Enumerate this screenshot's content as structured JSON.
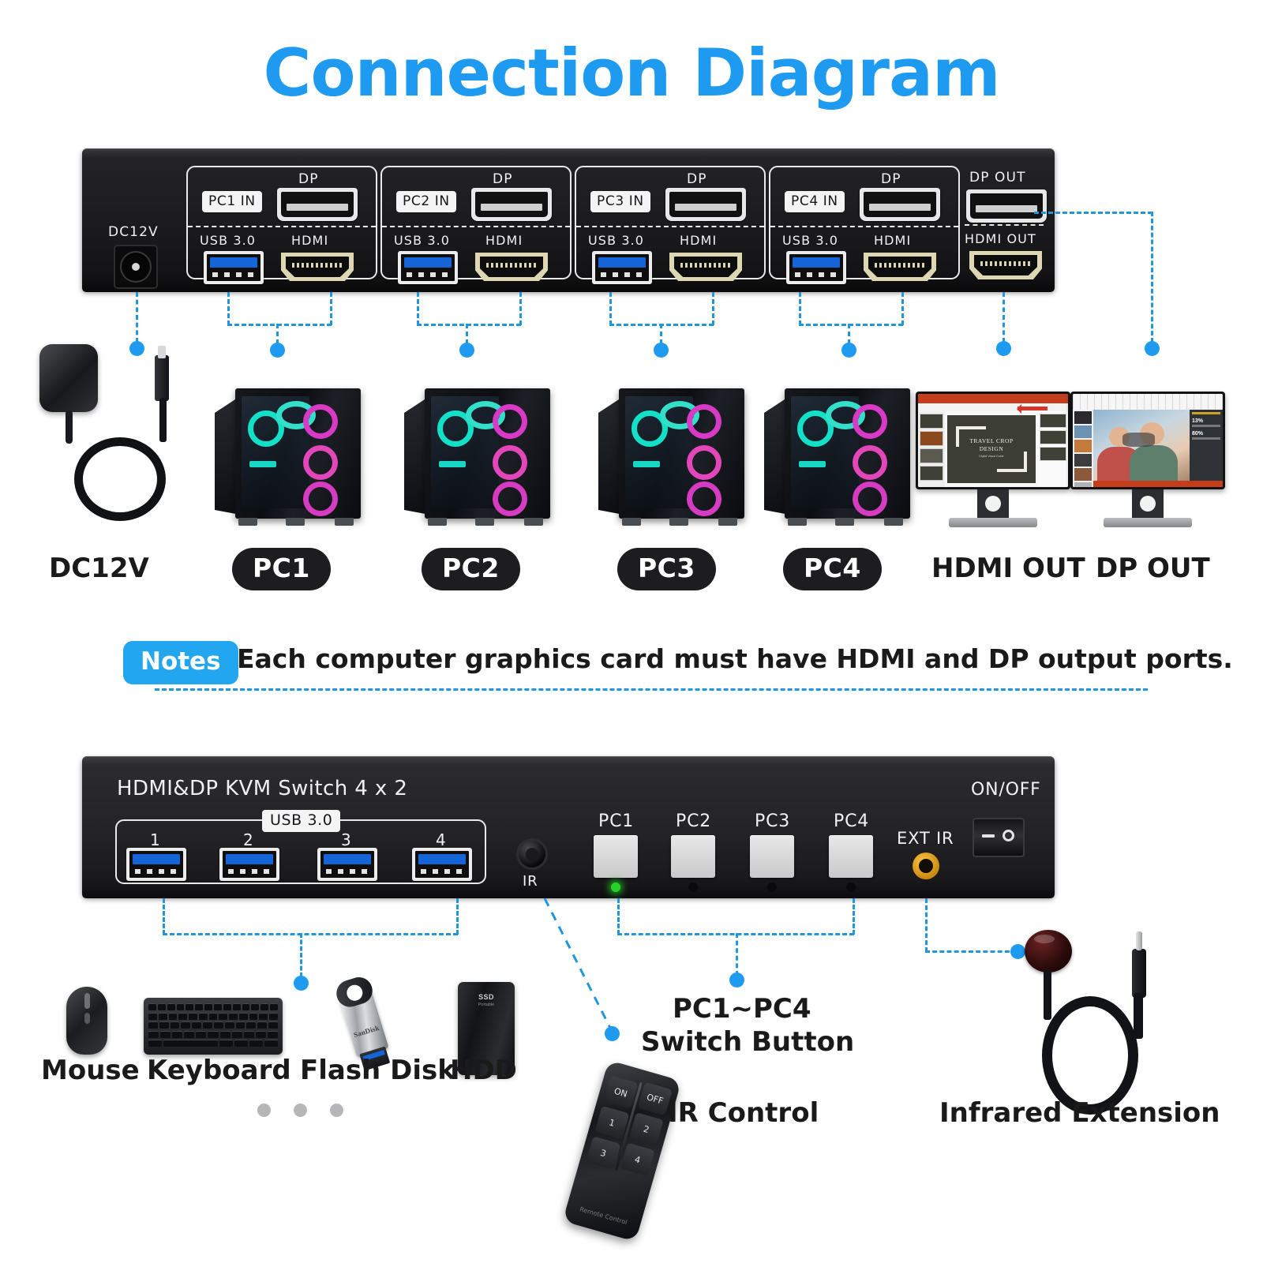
{
  "title": "Connection Diagram",
  "colors": {
    "accent": "#1E9BF0",
    "line": "#2196dd",
    "panel": "#1b1b1d",
    "led_on": "#27d227",
    "ext_ir": "#f5a623"
  },
  "rear_panel": {
    "power_label": "DC12V",
    "groups": [
      {
        "tag": "PC1 IN",
        "dp": "DP",
        "usb": "USB 3.0",
        "hdmi": "HDMI"
      },
      {
        "tag": "PC2 IN",
        "dp": "DP",
        "usb": "USB 3.0",
        "hdmi": "HDMI"
      },
      {
        "tag": "PC3 IN",
        "dp": "DP",
        "usb": "USB 3.0",
        "hdmi": "HDMI"
      },
      {
        "tag": "PC4 IN",
        "dp": "DP",
        "usb": "USB 3.0",
        "hdmi": "HDMI"
      }
    ],
    "outputs": {
      "dp_out": "DP OUT",
      "hdmi_out": "HDMI OUT"
    }
  },
  "devices": {
    "power_adapter": "DC12V",
    "pcs": [
      "PC1",
      "PC2",
      "PC3",
      "PC4"
    ],
    "hdmi_monitor": "HDMI OUT",
    "dp_monitor": "DP OUT",
    "monitor_ppt": {
      "title_line1": "TRAVEL CROP",
      "title_line2": "DESIGN",
      "subtitle": "Digital Visual Guide"
    },
    "monitor_doc": {
      "stat1": "13%",
      "stat2": "80%"
    }
  },
  "notes": {
    "badge": "Notes",
    "text": "Each computer graphics card must have HDMI and DP output ports."
  },
  "front_panel": {
    "brand": "HDMI&DP KVM Switch 4 x 2",
    "usb_badge": "USB 3.0",
    "usb_numbers": [
      "1",
      "2",
      "3",
      "4"
    ],
    "ir_label": "IR",
    "buttons": [
      "PC1",
      "PC2",
      "PC3",
      "PC4"
    ],
    "ext_ir_label": "EXT IR",
    "power_label": "ON/OFF"
  },
  "peripherals": {
    "mouse": "Mouse",
    "keyboard": "Keyboard",
    "flash_disk": "Flash Disk",
    "flash_brand": "SanDisk",
    "hdd": "HDD",
    "hdd_logo": "SSD",
    "hdd_sub": "Portable"
  },
  "callouts": {
    "switch_button_line1": "PC1~PC4",
    "switch_button_line2": "Switch Button",
    "ir_control": "IR Control",
    "infrared_extension": "Infrared Extension"
  },
  "remote": {
    "on": "ON",
    "off": "OFF",
    "keys": [
      "1",
      "2",
      "3",
      "4"
    ],
    "footer": "Remote Control"
  }
}
